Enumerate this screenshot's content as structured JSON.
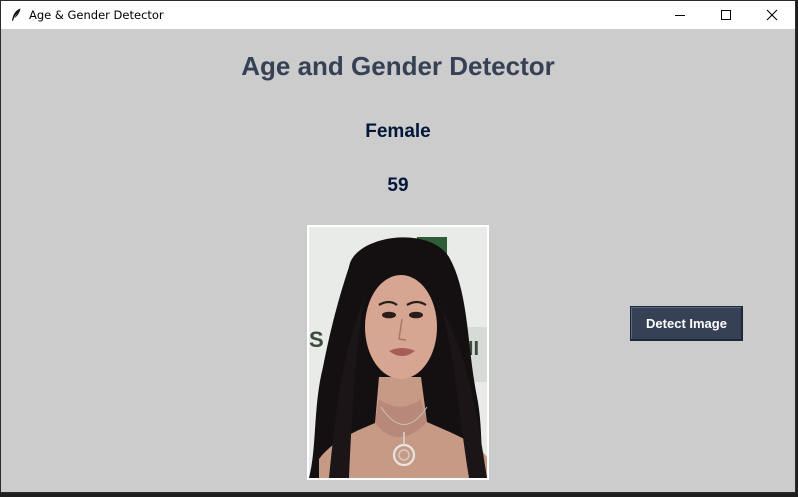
{
  "window": {
    "title": "Age & Gender Detector",
    "controls": [
      "minimize-icon",
      "maximize-icon",
      "close-icon"
    ],
    "app_icon": "feather-icon"
  },
  "main": {
    "heading": "Age and Gender Detector",
    "gender_label": "Female",
    "age_label": "59",
    "image_alt": "uploaded-face-photo",
    "detect_button": "Detect Image"
  },
  "colors": {
    "background": "#cccccc",
    "heading": "#364156",
    "result_text": "#011638",
    "button_bg": "#364156",
    "button_text": "#ffffff"
  }
}
